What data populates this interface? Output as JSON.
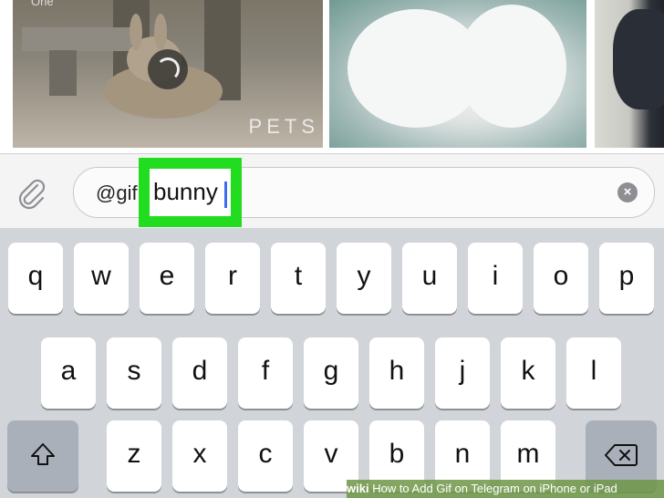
{
  "gif_results": {
    "corner_text": "One",
    "watermark": "PETS"
  },
  "input": {
    "prefix": "@gif",
    "query": "bunny"
  },
  "keyboard": {
    "row1": [
      "q",
      "w",
      "e",
      "r",
      "t",
      "y",
      "u",
      "i",
      "o",
      "p"
    ],
    "row2": [
      "a",
      "s",
      "d",
      "f",
      "g",
      "h",
      "j",
      "k",
      "l"
    ],
    "row3": [
      "z",
      "x",
      "c",
      "v",
      "b",
      "n",
      "m"
    ]
  },
  "watermark_bar": {
    "brand": "wiki",
    "title": "How to Add Gif on Telegram on iPhone or iPad"
  }
}
